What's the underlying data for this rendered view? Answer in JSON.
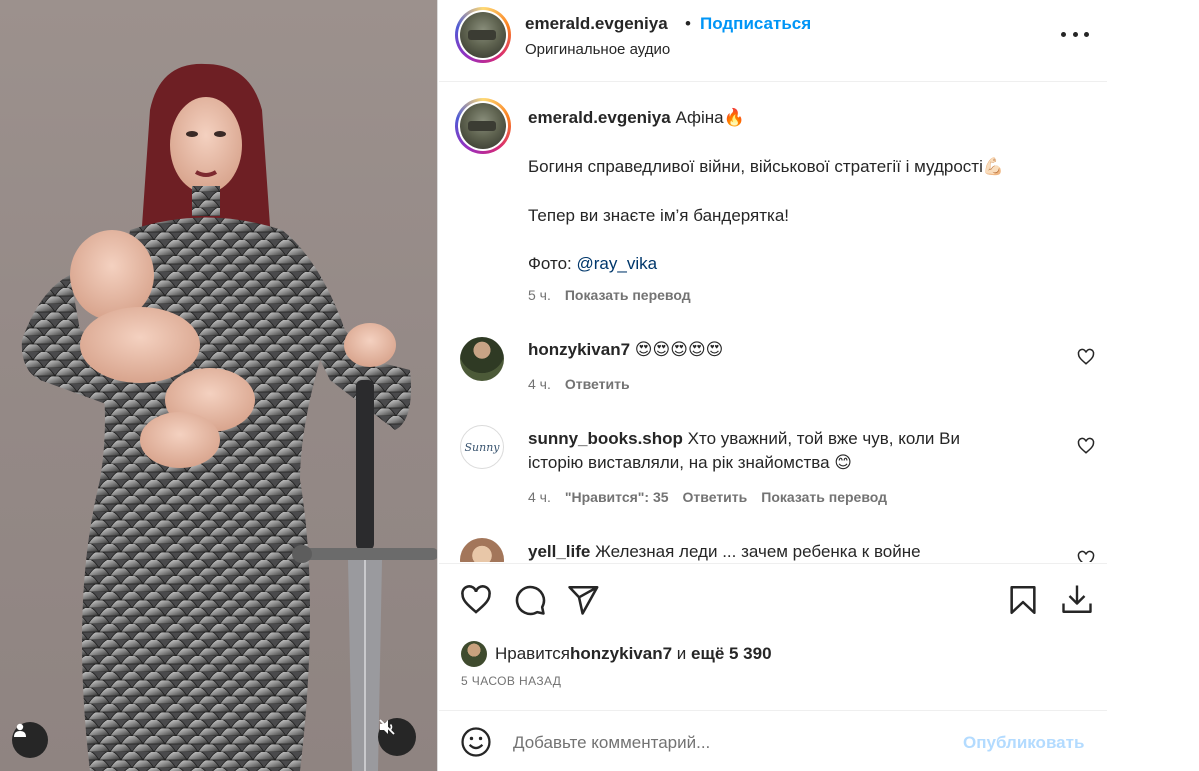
{
  "post": {
    "username": "emerald.evgeniya",
    "separator": "•",
    "follow_label": "Подписаться",
    "audio": "Оригинальное аудио"
  },
  "caption": {
    "username": "emerald.evgeniya",
    "title": "Афіна🔥",
    "line1": "Богиня справедливої війни, військової стратегії і мудрості💪🏻",
    "line2": "Тепер ви знаєте ім’я бандерятка!",
    "photo_prefix": "Фото: ",
    "photo_mention": "@ray_vika",
    "time": "5 ч.",
    "translate": "Показать перевод"
  },
  "comments": [
    {
      "username": "honzykivan7",
      "text": "😍😍😍😍😍",
      "time": "4 ч.",
      "reply": "Ответить"
    },
    {
      "username": "sunny_books.shop",
      "text": "Хто уважний, той вже чув, коли Ви історію виставляли, на рік знайомства 😊",
      "time": "4 ч.",
      "likes": "\"Нравится\": 35",
      "reply": "Ответить",
      "translate": "Показать перевод",
      "avatar_text": "Sunny"
    },
    {
      "username": "yell_life",
      "text": "Железная леди ... зачем ребенка к войне"
    }
  ],
  "likes": {
    "prefix": "Нравится ",
    "user": "honzykivan7",
    "middle": " и ",
    "count": "ещё 5 390"
  },
  "time_ago": "5 ЧАСОВ НАЗАД",
  "comment_box": {
    "placeholder": "Добавьте комментарий...",
    "publish": "Опубликовать"
  },
  "icons": {
    "like": "heart-icon",
    "comment": "comment-icon",
    "share": "send-icon",
    "save": "bookmark-icon",
    "download": "download-icon",
    "emoji": "emoji-icon",
    "user_tag": "user-icon",
    "mute": "speaker-muted-icon"
  },
  "colors": {
    "accent": "#0095f6",
    "text": "#262626",
    "secondary": "#737373",
    "mention": "#00376b",
    "publish_disabled": "#b3dbff"
  }
}
